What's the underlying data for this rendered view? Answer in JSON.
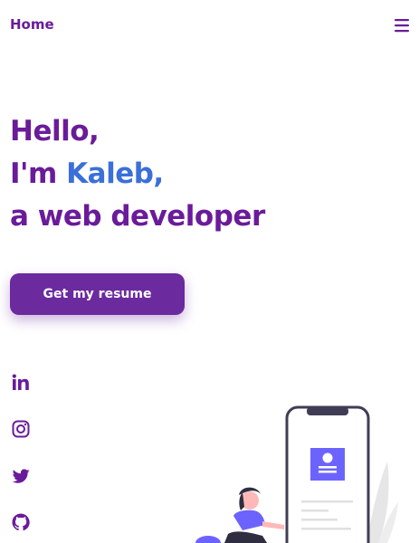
{
  "nav": {
    "logo": "Home",
    "menu_icon": "menu-icon"
  },
  "hero": {
    "line1": "Hello,",
    "line2_prefix": "I'm ",
    "line2_name": "Kaleb,",
    "line3": "a web developer",
    "cta_label": "Get my resume"
  },
  "social": [
    {
      "icon": "linkedin-icon"
    },
    {
      "icon": "instagram-icon"
    },
    {
      "icon": "twitter-icon"
    },
    {
      "icon": "github-icon"
    }
  ],
  "colors": {
    "primary": "#6a1b9a",
    "accent": "#3b6fd9",
    "button": "#6b2a9e"
  }
}
